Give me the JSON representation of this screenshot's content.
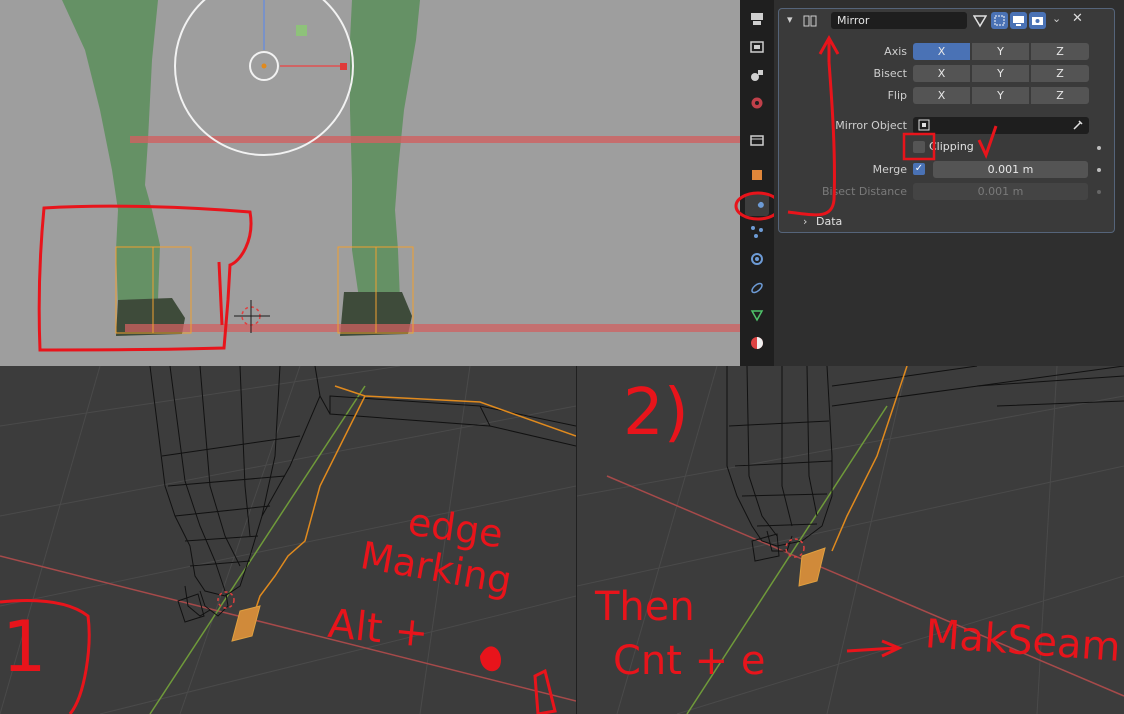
{
  "modifier": {
    "name": "Mirror",
    "axis_label": "Axis",
    "bisect_label": "Bisect",
    "flip_label": "Flip",
    "x": "X",
    "y": "Y",
    "z": "Z",
    "mirror_object_label": "Mirror Object",
    "clipping_label": "Clipping",
    "clipping_checked": false,
    "merge_label": "Merge",
    "merge_checked": true,
    "merge_value": "0.001 m",
    "bisect_distance_label": "Bisect Distance",
    "bisect_distance_value": "0.001 m",
    "data_section_label": "Data"
  },
  "annotations": {
    "step1_number": "1",
    "step2_number": "2)",
    "edge_marking_line1": "edge",
    "edge_marking_line2": "Marking",
    "alt_shortcut": "Alt +",
    "then": "Then",
    "ctrl_e": "Cnt + e",
    "arrow": "→",
    "mark_seam": "MakSeam"
  },
  "colors": {
    "axis_active": "#4a72b5",
    "annotation_red": "#e8141b",
    "selection_orange": "#f0a030",
    "viewport_top_bg": "#9e9e9e",
    "viewport_bottom_bg": "#3c3c3c",
    "mesh_green": "#5e8f5e"
  },
  "icons": [
    "render-icon",
    "output-icon",
    "view-layer-icon",
    "scene-icon",
    "world-icon",
    "collection-icon",
    "object-icon",
    "modifier-wrench-icon",
    "particles-icon",
    "physics-icon",
    "constraints-icon",
    "object-data-icon",
    "material-icon"
  ]
}
